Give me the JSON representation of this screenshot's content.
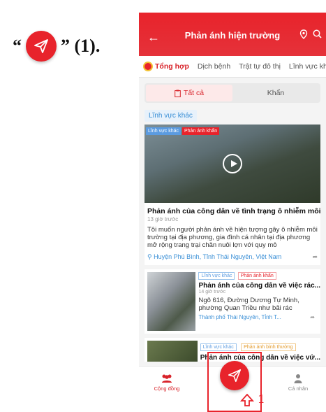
{
  "instruction": {
    "open_quote": "“",
    "close_quote_label": "” (1)."
  },
  "header": {
    "title": "Phản ánh hiện trường"
  },
  "tabs": [
    "Tổng hợp",
    "Dịch bệnh",
    "Trật tự đô thị",
    "Lĩnh vực khác"
  ],
  "tabs_more": "»",
  "segment": {
    "all": "Tất cả",
    "urgent": "Khẩn"
  },
  "category_label": "Lĩnh vực khác",
  "card1": {
    "tag_field": "Lĩnh vực khác",
    "tag_urgent": "Phản ánh khẩn",
    "title": "Phản ánh của công dân về tình trạng ô nhiễm môi trườ...",
    "time": "13 giờ trước",
    "description": "Tôi muốn người phản ánh về hiện tượng gây ô nhiễm môi trường tại địa phương, gia đình cá nhân tại địa phương mở rộng trang trại chăn nuôi lợn với quy mô",
    "location": "Huyện Phú Bình, Tỉnh Thái Nguyên, Việt Nam"
  },
  "card2": {
    "tag_field": "Lĩnh vực khác",
    "tag_urgent": "Phản ánh khẩn",
    "title": "Phản ánh của công dân về việc rác...",
    "time": "14 giờ trước",
    "address": "Ngõ 616, Đường Dương Tự Minh, phường Quan Triều như bãi rác",
    "location": "Thành phố Thái Nguyên, Tỉnh T..."
  },
  "card3": {
    "tag_field": "Lĩnh vực khác",
    "tag_normal": "Phản ánh bình thường",
    "title": "Phản ánh của công dân về việc vứ..."
  },
  "bottom_nav": {
    "community": "Cộng đồng",
    "personal": "Cá nhân"
  },
  "marker_label": "1",
  "colors": {
    "brand_red": "#e8232b",
    "link_blue": "#3a8fd6"
  }
}
